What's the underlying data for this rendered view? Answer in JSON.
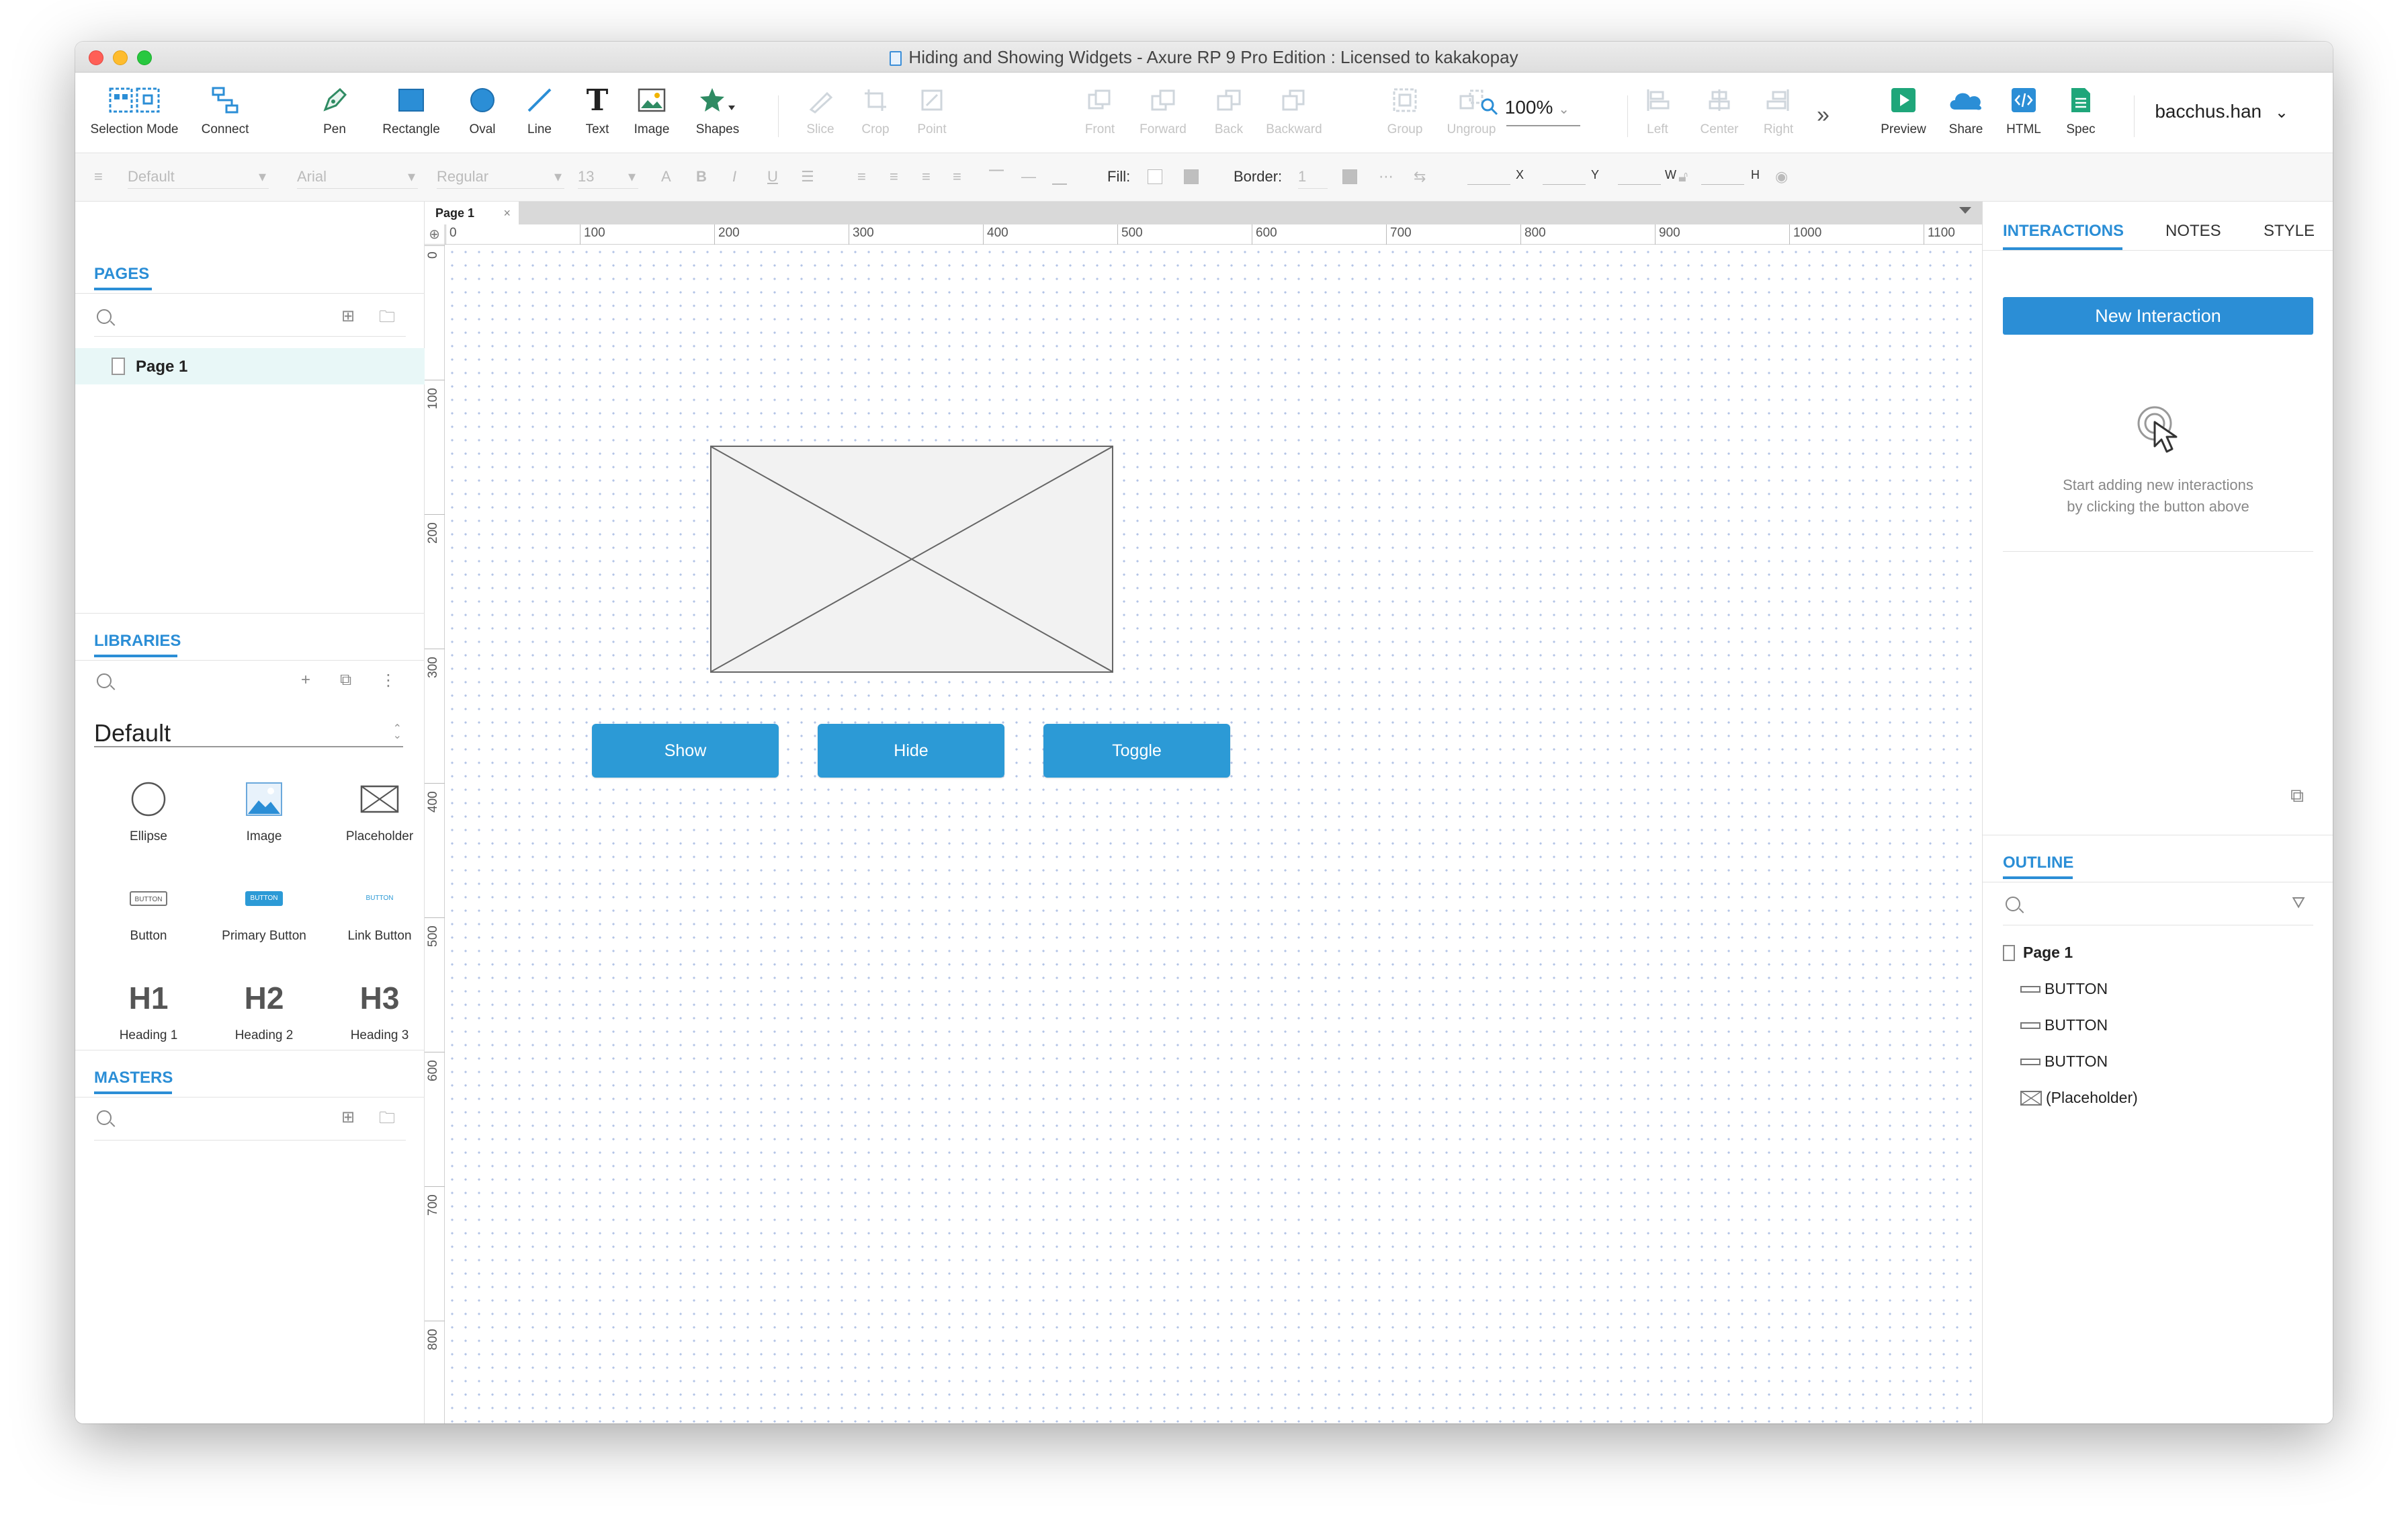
{
  "window": {
    "title": "Hiding and Showing Widgets - Axure RP 9 Pro Edition : Licensed to kakakopay"
  },
  "toolbar": {
    "items": [
      {
        "label": "Selection Mode",
        "icon": "selection-mode-icon"
      },
      {
        "label": "Connect",
        "icon": "connect-icon"
      },
      {
        "label": "Pen",
        "icon": "pen-icon"
      },
      {
        "label": "Rectangle",
        "icon": "rectangle-icon"
      },
      {
        "label": "Oval",
        "icon": "oval-icon"
      },
      {
        "label": "Line",
        "icon": "line-icon"
      },
      {
        "label": "Text",
        "icon": "text-icon"
      },
      {
        "label": "Image",
        "icon": "image-icon"
      },
      {
        "label": "Shapes",
        "icon": "star-icon"
      },
      {
        "label": "Slice",
        "icon": "slice-icon"
      },
      {
        "label": "Crop",
        "icon": "crop-icon"
      },
      {
        "label": "Point",
        "icon": "point-icon"
      },
      {
        "label": "Front",
        "icon": "front-icon"
      },
      {
        "label": "Forward",
        "icon": "forward-icon"
      },
      {
        "label": "Back",
        "icon": "back-icon"
      },
      {
        "label": "Backward",
        "icon": "backward-icon"
      },
      {
        "label": "Group",
        "icon": "group-icon"
      },
      {
        "label": "Ungroup",
        "icon": "ungroup-icon"
      },
      {
        "label": "Left",
        "icon": "align-left-icon"
      },
      {
        "label": "Center",
        "icon": "align-center-icon"
      },
      {
        "label": "Right",
        "icon": "align-right-icon"
      },
      {
        "label": "Preview",
        "icon": "play-icon"
      },
      {
        "label": "Share",
        "icon": "cloud-icon"
      },
      {
        "label": "HTML",
        "icon": "html-code-icon"
      },
      {
        "label": "Spec",
        "icon": "spec-document-icon"
      }
    ],
    "zoom": "100%",
    "user": "bacchus.han"
  },
  "format": {
    "style": "Default",
    "font": "Arial",
    "weight": "Regular",
    "size": "13",
    "fill_label": "Fill:",
    "border_label": "Border:",
    "border_value": "1",
    "x": "X",
    "y": "Y",
    "w": "W",
    "h": "H"
  },
  "pages": {
    "title": "PAGES",
    "items": [
      {
        "label": "Page 1"
      }
    ]
  },
  "libraries": {
    "title": "LIBRARIES",
    "selected": "Default",
    "items": [
      {
        "label": "Ellipse"
      },
      {
        "label": "Image"
      },
      {
        "label": "Placeholder"
      },
      {
        "label": "Button",
        "glyph": "BUTTON"
      },
      {
        "label": "Primary Button",
        "glyph": "BUTTON"
      },
      {
        "label": "Link Button",
        "glyph": "BUTTON"
      },
      {
        "label": "Heading 1",
        "glyph": "H1"
      },
      {
        "label": "Heading 2",
        "glyph": "H2"
      },
      {
        "label": "Heading 3",
        "glyph": "H3"
      }
    ]
  },
  "masters": {
    "title": "MASTERS"
  },
  "canvas": {
    "tab": "Page 1",
    "ruler_x": [
      "0",
      "100",
      "200",
      "300",
      "400",
      "500",
      "600",
      "700",
      "800",
      "900",
      "1000",
      "1100"
    ],
    "ruler_y": [
      "0",
      "100",
      "200",
      "300",
      "400",
      "500",
      "600",
      "700",
      "800"
    ],
    "buttons": [
      {
        "label": "Show"
      },
      {
        "label": "Hide"
      },
      {
        "label": "Toggle"
      }
    ],
    "accent": "#2c9ad6"
  },
  "right": {
    "tabs": [
      "INTERACTIONS",
      "NOTES",
      "STYLE"
    ],
    "new_interaction": "New Interaction",
    "hint_line1": "Start adding new interactions",
    "hint_line2": "by clicking the button above"
  },
  "outline": {
    "title": "OUTLINE",
    "page": "Page 1",
    "items": [
      {
        "label": "BUTTON"
      },
      {
        "label": "BUTTON"
      },
      {
        "label": "BUTTON"
      },
      {
        "label": "(Placeholder)"
      }
    ]
  }
}
